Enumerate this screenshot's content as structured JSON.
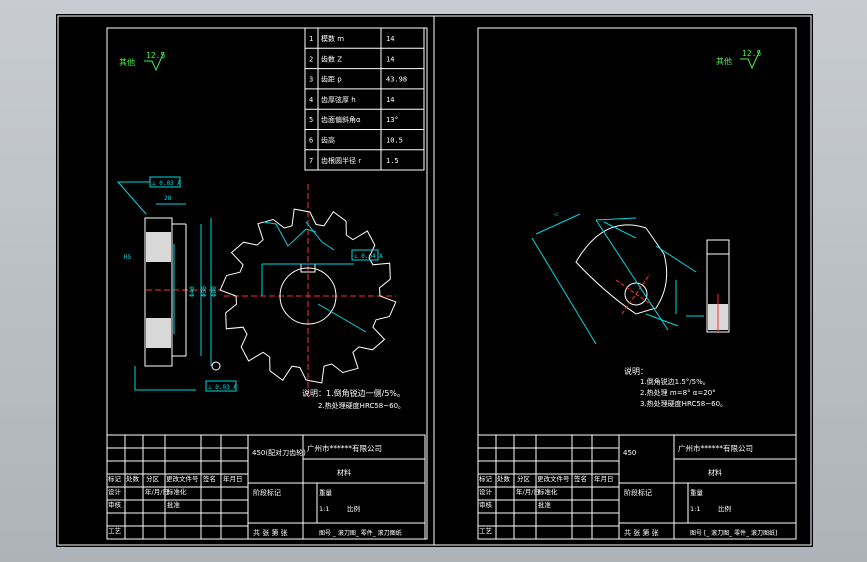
{
  "colors": {
    "border": "#ffffff",
    "dim": "#00d8e0",
    "green": "#44ee44",
    "red": "#ff3030",
    "magenta": "#ff40ff",
    "text": "#ffffff",
    "gear": "#ffffff"
  },
  "sheet1": {
    "roughness": {
      "label": "其他",
      "value": "12.5"
    },
    "params": [
      {
        "no": "1",
        "name": "模数 m",
        "value": "14"
      },
      {
        "no": "2",
        "name": "齿数 Z",
        "value": "14"
      },
      {
        "no": "3",
        "name": "齿距 p",
        "value": "43.98"
      },
      {
        "no": "4",
        "name": "齿厚弦厚 h",
        "value": "14"
      },
      {
        "no": "5",
        "name": "齿面偏斜角α",
        "value": "13°"
      },
      {
        "no": "6",
        "name": "齿高",
        "value": "10.5"
      },
      {
        "no": "7",
        "name": "齿根圆半径 r",
        "value": "1.5"
      }
    ],
    "notes": {
      "title": "说明：",
      "l1": "1.倒角锐边一侧/5%。",
      "l2": "2.热处理硬度HRC58~60。"
    },
    "tol_frames": {
      "top": "⊥ 0.03 A",
      "mid": "⊥ 0.04 A",
      "bot": "⊥ 0.03 A"
    },
    "dims": {
      "d1": "Φ40",
      "d2": "Φ50",
      "d3": "Φ80",
      "w": "28",
      "r": "R5"
    },
    "title_block": {
      "part_name": "450(配对刀齿轮)",
      "company": "广州市******有限公司",
      "material": "材料",
      "stage": "阶段标记",
      "weight": "重量",
      "scale": "比例",
      "scale_value": "1:1",
      "sheet": "共   张  第   张",
      "footer": "图号 _ 滚刀图_ 零件_ 滚刀图纸",
      "h_mark": "标记",
      "h_count": "处数",
      "h_zone": "分区",
      "h_doc": "更改文件号",
      "h_sign": "签名",
      "h_date": "年月日",
      "r_design": "设计",
      "r_check": "审核",
      "r_proc": "工艺",
      "r_std": "标准化",
      "r_appr": "批准",
      "r_date": "年/月/日",
      "std": "标准化"
    }
  },
  "sheet2": {
    "roughness": {
      "label": "其他",
      "value": "12.5"
    },
    "notes": {
      "title": "说明：",
      "l1": "1.倒角锐边1.5°/5%。",
      "l2": "2.热处理 m=8° α=20°",
      "l3": "3.热处理硬度HRC58~60。"
    },
    "title_block": {
      "part_name": "450",
      "company": "广州市******有限公司",
      "material": "材料",
      "stage": "阶段标记",
      "weight": "重量",
      "scale": "比例",
      "scale_value": "1:1",
      "sheet": "共   张  第   张",
      "footer": "图号 [_ 滚刀图_ 零件_ 滚刀图纸]",
      "h_mark": "标记",
      "h_count": "处数",
      "h_zone": "分区",
      "h_doc": "更改文件号",
      "h_sign": "签名",
      "h_date": "年月日",
      "r_design": "设计",
      "r_check": "审核",
      "r_proc": "工艺",
      "r_std": "标准化",
      "r_appr": "批准",
      "r_date": "年/月/日",
      "std": "标准化"
    }
  }
}
